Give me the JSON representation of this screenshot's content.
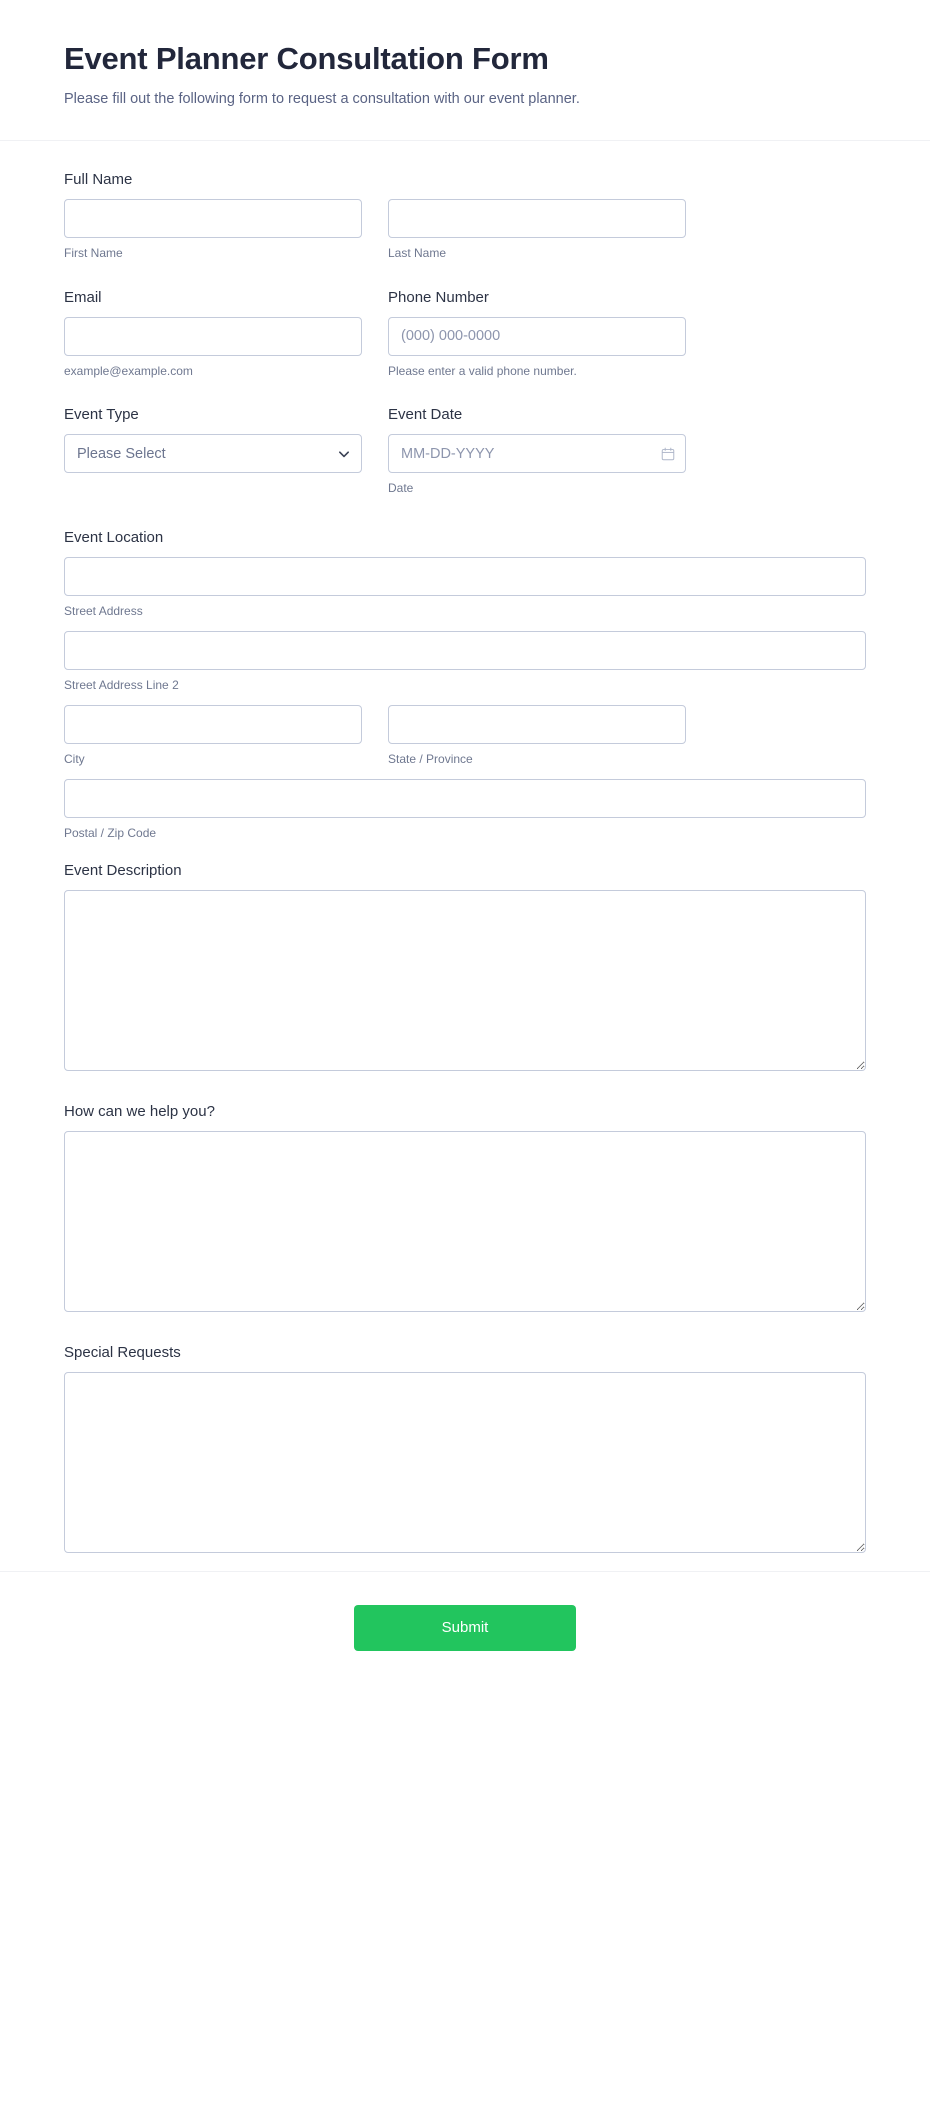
{
  "header": {
    "title": "Event Planner Consultation Form",
    "subtitle": "Please fill out the following form to request a consultation with our event planner."
  },
  "fields": {
    "full_name": {
      "label": "Full Name",
      "first": {
        "value": "",
        "placeholder": "",
        "sublabel": "First Name"
      },
      "last": {
        "value": "",
        "placeholder": "",
        "sublabel": "Last Name"
      }
    },
    "email": {
      "label": "Email",
      "value": "",
      "placeholder": "",
      "sublabel": "example@example.com"
    },
    "phone": {
      "label": "Phone Number",
      "value": "",
      "placeholder": "(000) 000-0000",
      "sublabel": "Please enter a valid phone number."
    },
    "event_type": {
      "label": "Event Type",
      "selected": "Please Select",
      "options": [
        "Please Select"
      ],
      "icon": "chevron-down-icon"
    },
    "event_date": {
      "label": "Event Date",
      "value": "",
      "placeholder": "MM-DD-YYYY",
      "sublabel": "Date",
      "icon": "calendar-icon"
    },
    "event_location": {
      "label": "Event Location",
      "street": {
        "value": "",
        "placeholder": "",
        "sublabel": "Street Address"
      },
      "street2": {
        "value": "",
        "placeholder": "",
        "sublabel": "Street Address Line 2"
      },
      "city": {
        "value": "",
        "placeholder": "",
        "sublabel": "City"
      },
      "state": {
        "value": "",
        "placeholder": "",
        "sublabel": "State / Province"
      },
      "postal": {
        "value": "",
        "placeholder": "",
        "sublabel": "Postal / Zip Code"
      }
    },
    "event_description": {
      "label": "Event Description",
      "value": "",
      "placeholder": ""
    },
    "how_help": {
      "label": "How can we help you?",
      "value": "",
      "placeholder": ""
    },
    "special_requests": {
      "label": "Special Requests",
      "value": "",
      "placeholder": ""
    }
  },
  "footer": {
    "submit_label": "Submit"
  },
  "colors": {
    "title": "#22273b",
    "subtitle": "#5a6384",
    "label": "#2c3345",
    "sublabel": "#6f7890",
    "border": "#c4cbdb",
    "placeholder": "#8d95ad",
    "submit_bg": "#22c55e",
    "submit_text": "#ffffff",
    "divider": "#f0f1f4"
  }
}
